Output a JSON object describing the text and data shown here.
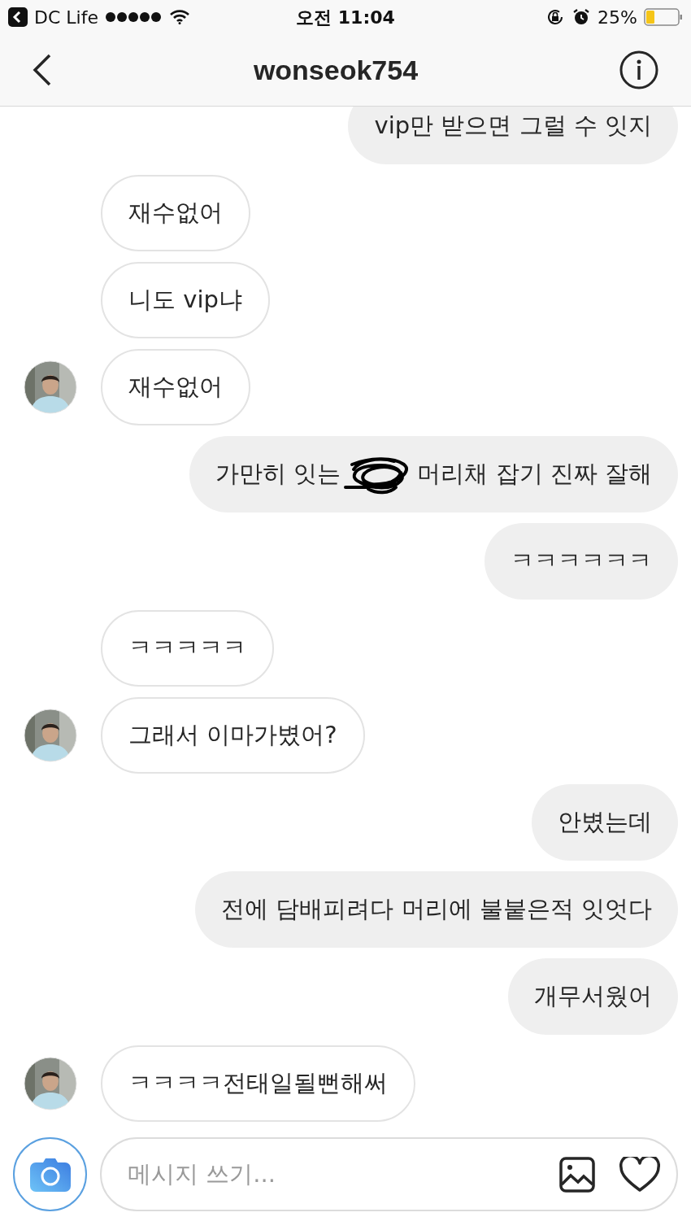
{
  "status_bar": {
    "back_app": "DC Life",
    "time": "오전 11:04",
    "battery": "25%"
  },
  "header": {
    "title": "wonseok754"
  },
  "messages": [
    {
      "kind": "outgoing",
      "text": "vip만 받으면 그럴 수 잇지"
    },
    {
      "kind": "incoming",
      "avatar": false,
      "text": "재수없어"
    },
    {
      "kind": "incoming",
      "avatar": false,
      "text": "니도 vip냐"
    },
    {
      "kind": "incoming",
      "avatar": true,
      "text": "재수없어"
    },
    {
      "kind": "outgoing",
      "text_before": "가만히 잇는",
      "text_after": "머리채 잡기 진짜 잘해"
    },
    {
      "kind": "outgoing",
      "text": "ㅋㅋㅋㅋㅋㅋ"
    },
    {
      "kind": "incoming",
      "avatar": false,
      "text": "ㅋㅋㅋㅋㅋ"
    },
    {
      "kind": "incoming",
      "avatar": true,
      "text": "그래서 이마가볐어?"
    },
    {
      "kind": "outgoing",
      "text": "안볐는데"
    },
    {
      "kind": "outgoing",
      "text": "전에 담배피려다 머리에 불붙은적 잇엇다"
    },
    {
      "kind": "outgoing",
      "text": "개무서웠어"
    },
    {
      "kind": "incoming",
      "avatar": true,
      "text": "ㅋㅋㅋㅋ전태일될뻔해써"
    }
  ],
  "composer": {
    "placeholder": "메시지 쓰기..."
  }
}
